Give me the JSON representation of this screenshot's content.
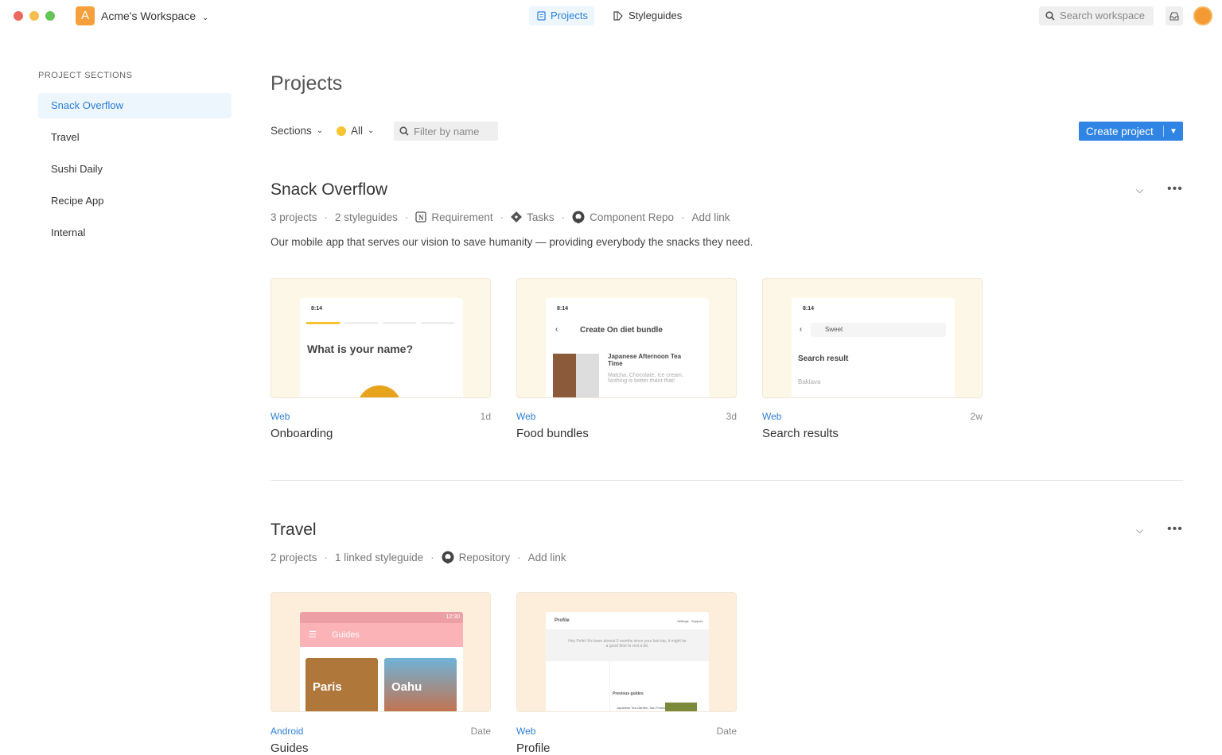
{
  "window": {
    "controls": [
      "close",
      "minimize",
      "maximize"
    ]
  },
  "header": {
    "workspace_initial": "A",
    "workspace_name": "Acme's Workspace",
    "tabs": [
      {
        "label": "Projects",
        "icon": "document-icon",
        "active": true
      },
      {
        "label": "Styleguides",
        "icon": "styleguide-icon",
        "active": false
      }
    ],
    "search_placeholder": "Search workspace"
  },
  "sidebar": {
    "heading": "PROJECT SECTIONS",
    "items": [
      {
        "label": "Snack Overflow",
        "active": true
      },
      {
        "label": "Travel"
      },
      {
        "label": "Sushi Daily"
      },
      {
        "label": "Recipe App"
      },
      {
        "label": "Internal"
      }
    ]
  },
  "main": {
    "title": "Projects",
    "filters": {
      "sections_label": "Sections",
      "status_label": "All",
      "status_color": "#f7c531",
      "filter_placeholder": "Filter by name"
    },
    "create_label": "Create project",
    "sections": [
      {
        "title": "Snack Overflow",
        "projects_count": "3 projects",
        "styleguides": "2 styleguides",
        "links": [
          {
            "label": "Requirement",
            "icon": "notion-icon"
          },
          {
            "label": "Tasks",
            "icon": "diamond-icon"
          },
          {
            "label": "Component Repo",
            "icon": "github-icon"
          }
        ],
        "add_link": "Add link",
        "description": "Our mobile app that serves our vision to save humanity — providing everybody the snacks they need.",
        "cards": [
          {
            "platform": "Web",
            "age": "1d",
            "name": "Onboarding",
            "bg": "#fdf7e8",
            "preview": {
              "time": "8:14",
              "heading": "What is your name?"
            }
          },
          {
            "platform": "Web",
            "age": "3d",
            "name": "Food bundles",
            "bg": "#fdf7e8",
            "preview": {
              "time": "8:14",
              "heading": "Create On diet bundle",
              "item_title": "Japanese Afternoon Tea Time",
              "item_desc": "Matcha, Chocolate, Ice cream. Nothing is better thant that!"
            }
          },
          {
            "platform": "Web",
            "age": "2w",
            "name": "Search results",
            "bg": "#fdf7e8",
            "preview": {
              "time": "8:14",
              "query": "Sweet",
              "heading": "Search result",
              "result": "Baklava"
            }
          }
        ]
      },
      {
        "title": "Travel",
        "projects_count": "2 projects",
        "styleguides": "1 linked styleguide",
        "links": [
          {
            "label": "Repository",
            "icon": "github-icon"
          }
        ],
        "add_link": "Add link",
        "cards": [
          {
            "platform": "Android",
            "age": "Date",
            "name": "Guides",
            "bg": "#fdeedb",
            "preview": {
              "time": "12:30",
              "heading": "Guides",
              "tiles": [
                "Paris",
                "Oahu"
              ]
            }
          },
          {
            "platform": "Web",
            "age": "Date",
            "name": "Profile",
            "bg": "#fdeedb",
            "preview": {
              "heading": "Profile",
              "nav": [
                "Settings",
                "Support"
              ],
              "message": "Hey Pelin! It's been almost 3 months since your last trip, it might be a good time to rest a bit.",
              "subheading": "Previous guides",
              "guide": "Japanese Tea Garden, San Francisco"
            }
          }
        ]
      }
    ]
  }
}
